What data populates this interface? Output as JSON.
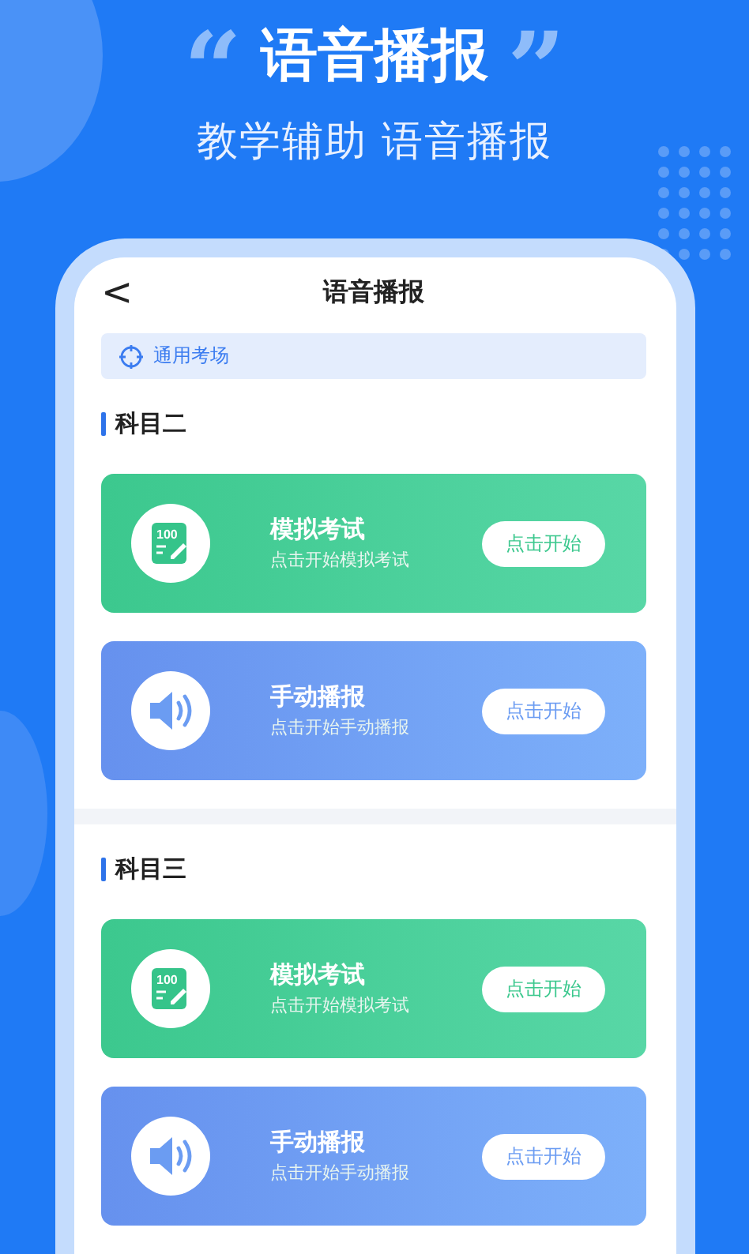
{
  "headline": {
    "quote_open": "“",
    "title": "语音播报",
    "quote_close": "”",
    "subtitle": "教学辅助  语音播报"
  },
  "screen": {
    "nav_title": "语音播报",
    "back": "<",
    "location": "通用考场",
    "sections": [
      {
        "title": "科目二",
        "cards": [
          {
            "kind": "exam",
            "icon_text": "100",
            "title": "模拟考试",
            "desc": "点击开始模拟考试",
            "button": "点击开始"
          },
          {
            "kind": "broadcast",
            "title": "手动播报",
            "desc": "点击开始手动播报",
            "button": "点击开始"
          }
        ]
      },
      {
        "title": "科目三",
        "cards": [
          {
            "kind": "exam",
            "icon_text": "100",
            "title": "模拟考试",
            "desc": "点击开始模拟考试",
            "button": "点击开始"
          },
          {
            "kind": "broadcast",
            "title": "手动播报",
            "desc": "点击开始手动播报",
            "button": "点击开始"
          }
        ]
      }
    ]
  }
}
